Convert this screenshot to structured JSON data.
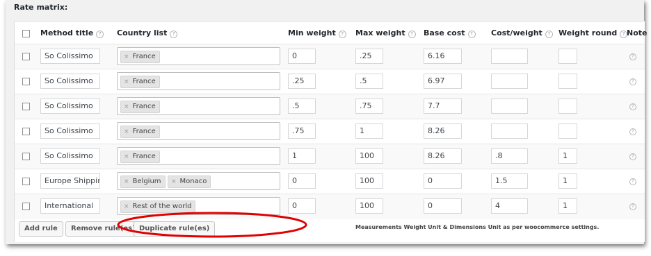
{
  "section_title": "Rate matrix:",
  "headers": {
    "method_title": "Method title",
    "country_list": "Country list",
    "min_weight": "Min weight",
    "max_weight": "Max weight",
    "base_cost": "Base cost",
    "cost_weight": "Cost/weight",
    "weight_round": "Weight round",
    "note": "Note"
  },
  "help_glyph": "?",
  "rows": [
    {
      "method": "So Colissimo",
      "countries": [
        "France"
      ],
      "min": "0",
      "max": ".25",
      "base": "6.16",
      "cost_weight": "",
      "round": ""
    },
    {
      "method": "So Colissimo",
      "countries": [
        "France"
      ],
      "min": ".25",
      "max": ".5",
      "base": "6.97",
      "cost_weight": "",
      "round": ""
    },
    {
      "method": "So Colissimo",
      "countries": [
        "France"
      ],
      "min": ".5",
      "max": ".75",
      "base": "7.7",
      "cost_weight": "",
      "round": ""
    },
    {
      "method": "So Colissimo",
      "countries": [
        "France"
      ],
      "min": ".75",
      "max": "1",
      "base": "8.26",
      "cost_weight": "",
      "round": ""
    },
    {
      "method": "So Colissimo",
      "countries": [
        "France"
      ],
      "min": "1",
      "max": "100",
      "base": "8.26",
      "cost_weight": ".8",
      "round": "1"
    },
    {
      "method": "Europe Shippir",
      "countries": [
        "Belgium",
        "Monaco"
      ],
      "min": "0",
      "max": "100",
      "base": "0",
      "cost_weight": "1.5",
      "round": "1"
    },
    {
      "method": "International",
      "countries": [
        "Rest of the world"
      ],
      "min": "0",
      "max": "100",
      "base": "0",
      "cost_weight": "4",
      "round": "1"
    }
  ],
  "chip_remove_glyph": "×",
  "buttons": {
    "add_rule": "Add rule",
    "remove_rules": "Remove rule(es)",
    "duplicate_rules": "Duplicate rule(es)"
  },
  "footer_note": "Measurements Weight Unit & Dimensions Unit as per woocommerce settings.",
  "colors": {
    "highlight": "#e00000"
  }
}
